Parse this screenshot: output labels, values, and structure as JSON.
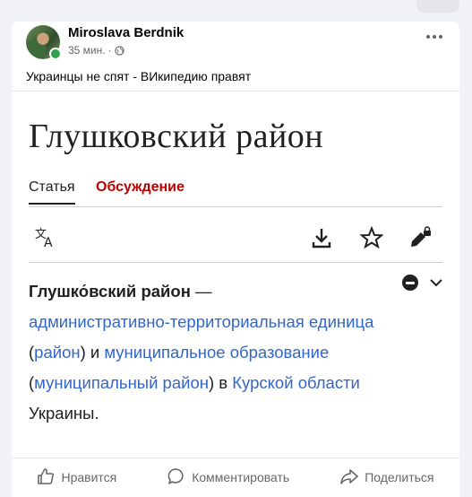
{
  "post": {
    "author": "Miroslava Berdnik",
    "time": "35 мин.",
    "separator": "·",
    "text": "Украинцы не спят - ВИкипедию правят"
  },
  "wiki": {
    "title": "Глушковский район",
    "tabs": [
      "Статья",
      "Обсуждение"
    ],
    "lead": {
      "bold": "Глушко́вский район",
      "dash": " — ",
      "link1": "административно-территориальная единица",
      "paren_open": "(",
      "link2": "район",
      "paren_close_and": ") и ",
      "link3": "муниципальное образование",
      "paren_open2": "(",
      "link4": "муниципальный район",
      "paren_close_in": ") в ",
      "link5": "Курской области",
      "tail": "Украины."
    },
    "icons": [
      "translate-icon",
      "download-icon",
      "star-icon",
      "edit-lock-icon"
    ]
  },
  "actions": {
    "like": "Нравится",
    "comment": "Комментировать",
    "share": "Поделиться"
  },
  "colors": {
    "link": "#3366cc",
    "talk_tab": "#ba0000",
    "online": "#31a24c"
  }
}
